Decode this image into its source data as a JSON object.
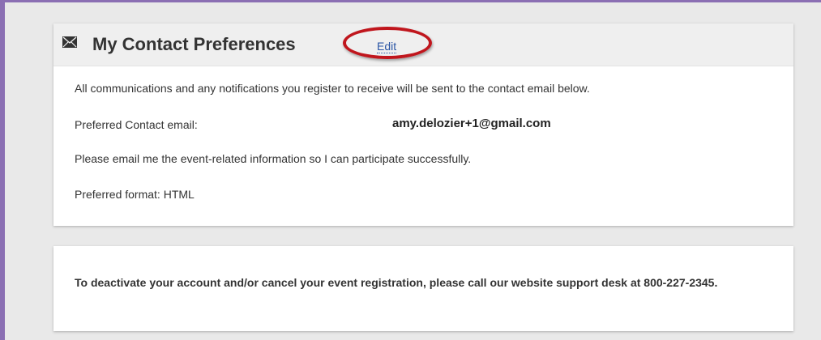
{
  "contact_preferences": {
    "title": "My Contact Preferences",
    "edit_label": "Edit",
    "intro": "All communications and any notifications you register to receive will be sent to the contact email below.",
    "email_label": "Preferred Contact email:",
    "email_value": "amy.delozier+1@gmail.com",
    "event_info_note": "Please email me the event-related information so I can participate successfully.",
    "format_line": "Preferred format: HTML"
  },
  "deactivate": {
    "message": "To deactivate your account and/or cancel your event registration, please call our website support desk at 800-227-2345."
  },
  "colors": {
    "frame_border": "#8b6fb3",
    "highlight_ring": "#c0161d",
    "link": "#2a55a5"
  },
  "icons": {
    "header_icon": "envelope-icon"
  }
}
